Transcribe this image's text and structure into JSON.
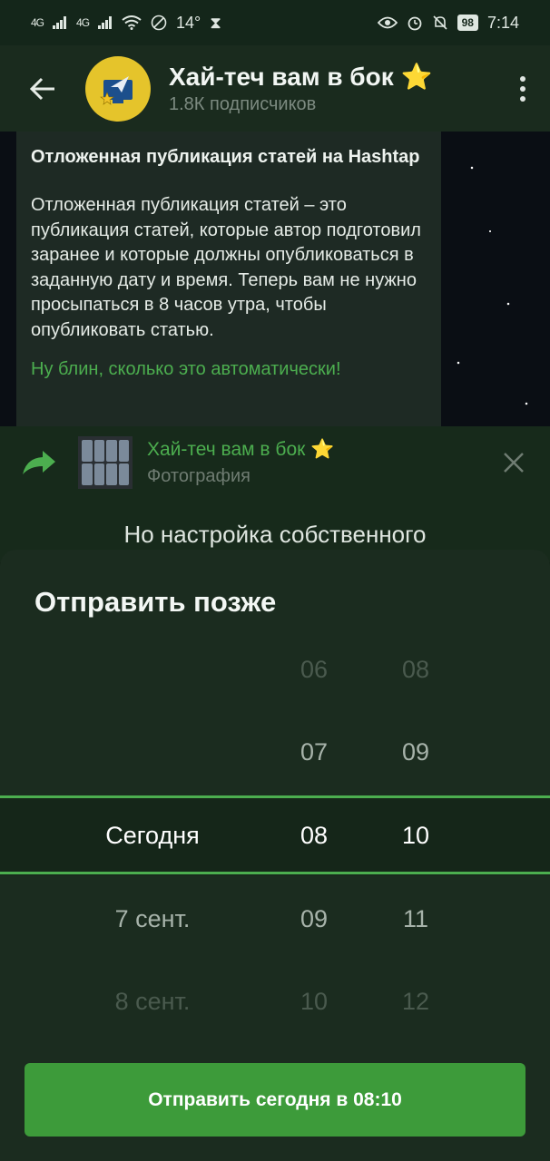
{
  "status_bar": {
    "signal1": "4G",
    "signal2": "4G",
    "temperature": "14°",
    "battery": "98",
    "time": "7:14"
  },
  "header": {
    "title": "Хай-теч вам в бок ⭐",
    "subscribers": "1.8К подписчиков"
  },
  "post": {
    "title": "Отложенная публикация статей на Hashtap",
    "body": "Отложенная публикация статей – это публикация статей, которые автор подготовил заранее и которые должны опубликоваться в заданную дату и время. Теперь вам не нужно просыпаться в 8 часов утра, чтобы опубликовать статью.",
    "link_partial": "Ну блин, сколько это автоматически!"
  },
  "reply": {
    "channel": "Хай-теч вам в бок ⭐",
    "type": "Фотография"
  },
  "behind_text": "Но настройка собственного",
  "sheet": {
    "title": "Отправить позже",
    "dates": [
      "",
      "",
      "Сегодня",
      "7 сент.",
      "8 сент."
    ],
    "hours": [
      "06",
      "07",
      "08",
      "09",
      "10"
    ],
    "minutes": [
      "08",
      "09",
      "10",
      "11",
      "12"
    ],
    "send_button": "Отправить сегодня в 08:10"
  },
  "colors": {
    "accent": "#4cae4f",
    "button": "#3d9b3a",
    "sheet_bg": "#1b2c1f"
  },
  "icons": [
    "back-arrow-icon",
    "more-vert-icon",
    "forward-icon",
    "close-icon",
    "wifi-icon",
    "alarm-icon",
    "eye-icon",
    "bell-off-icon"
  ]
}
